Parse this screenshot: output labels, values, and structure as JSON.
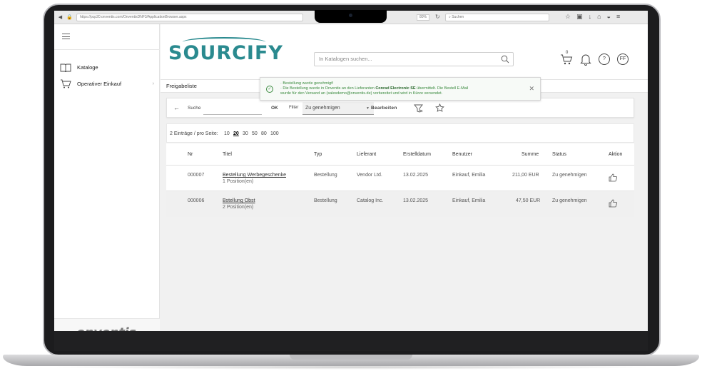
{
  "browser": {
    "url": "https://pcp20.onventis.com/OnventisDNF3/ApplicationBrowser.aspx",
    "zoom": "80%",
    "search_placeholder": "Suchen"
  },
  "sidebar": {
    "items": [
      {
        "label": "Kataloge",
        "icon": "book-icon"
      },
      {
        "label": "Operativer Einkauf",
        "icon": "cart-icon",
        "chevron": "›"
      }
    ],
    "logo_text": "onventis"
  },
  "header": {
    "brand": "SOURCIFY",
    "search_placeholder": "In Katalogen suchen...",
    "cart_count": "0",
    "help": "?",
    "user_initials": "FF"
  },
  "page": {
    "title": "Freigabeliste"
  },
  "notification": {
    "line1": "· Bestellung wurde genehmigt!",
    "line2_pre": "· Die Bestellung wurde in Onventis an den Lieferanten",
    "supplier": "Conrad Electronic SE",
    "line2_post": "übermittelt. Die Bestell E-Mail",
    "line3": "wurde für den Versand an (salesdemo@onventis.de) vorbereitet und wird in Kürze versendet."
  },
  "toolbar": {
    "back": "←",
    "search_label": "Suche",
    "ok_label": "OK",
    "filter_label": "Filter",
    "filter_value": "Zu genehmigen",
    "edit_label": "Bearbeiten"
  },
  "pagination": {
    "summary": "2 Einträge / pro Seite:",
    "options": [
      "10",
      "20",
      "30",
      "50",
      "80",
      "100"
    ],
    "selected": "20"
  },
  "table": {
    "headers": [
      "Nr",
      "Titel",
      "Typ",
      "Lieferant",
      "Erstelldatum",
      "Benutzer",
      "Summe",
      "Status",
      "Aktion"
    ],
    "rows": [
      {
        "nr": "000007",
        "title": "Bestellung Werbegeschenke",
        "positions": "1 Position(en)",
        "typ": "Bestellung",
        "lieferant": "Vendor Ltd.",
        "datum": "13.02.2025",
        "benutzer": "Einkauf, Emilia",
        "summe": "211,00 EUR",
        "status": "Zu genehmigen"
      },
      {
        "nr": "000006",
        "title": "Bstellung Obst",
        "positions": "2 Position(en)",
        "typ": "Bestellung",
        "lieferant": "Catalog Inc.",
        "datum": "13.02.2025",
        "benutzer": "Einkauf, Emilia",
        "summe": "47,50 EUR",
        "status": "Zu genehmigen"
      }
    ]
  },
  "colors": {
    "brand": "#2a8a8f",
    "success": "#3a8a3e",
    "frame": "#1c1c1e"
  }
}
